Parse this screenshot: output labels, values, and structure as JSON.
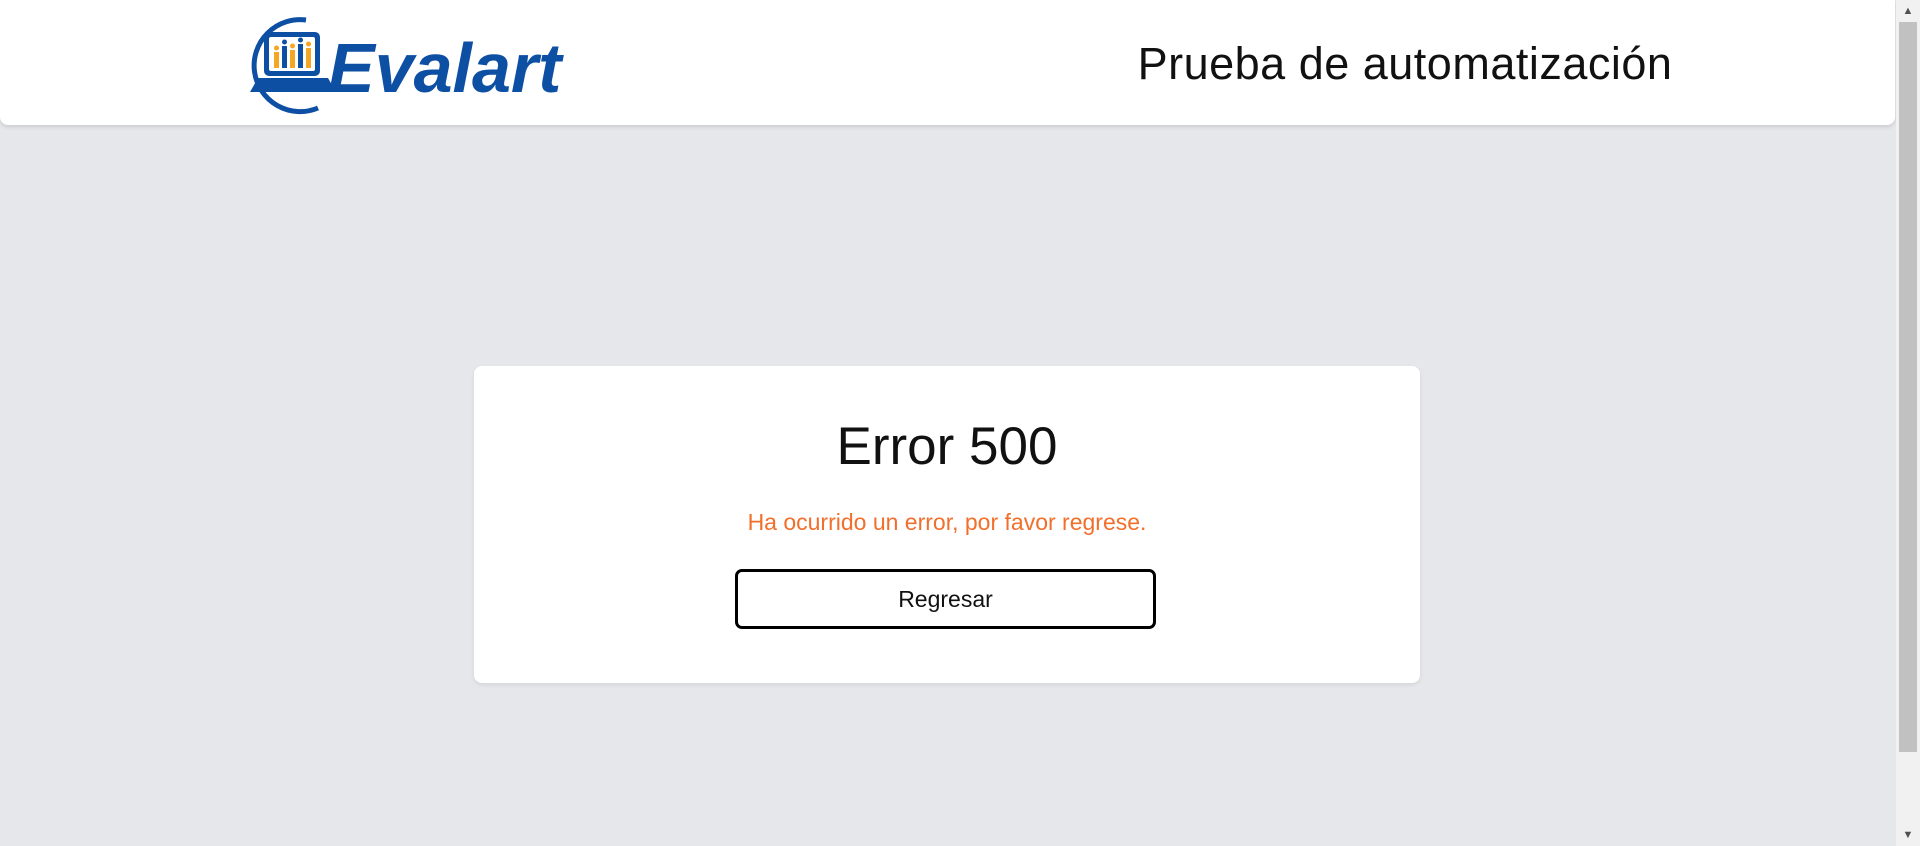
{
  "header": {
    "logo_text": "Evalart",
    "title": "Prueba de automatización"
  },
  "error_card": {
    "title": "Error 500",
    "message": "Ha ocurrido un error, por favor regrese.",
    "button_label": "Regresar"
  },
  "colors": {
    "page_background": "#e5e7eb",
    "message_text": "#f26f2b",
    "logo_blue": "#0d4fa3",
    "logo_orange": "#f5a623"
  },
  "icons": {
    "logo": "evalart-logo-icon",
    "scroll_up": "scroll-up-arrow-icon",
    "scroll_down": "scroll-down-arrow-icon"
  }
}
